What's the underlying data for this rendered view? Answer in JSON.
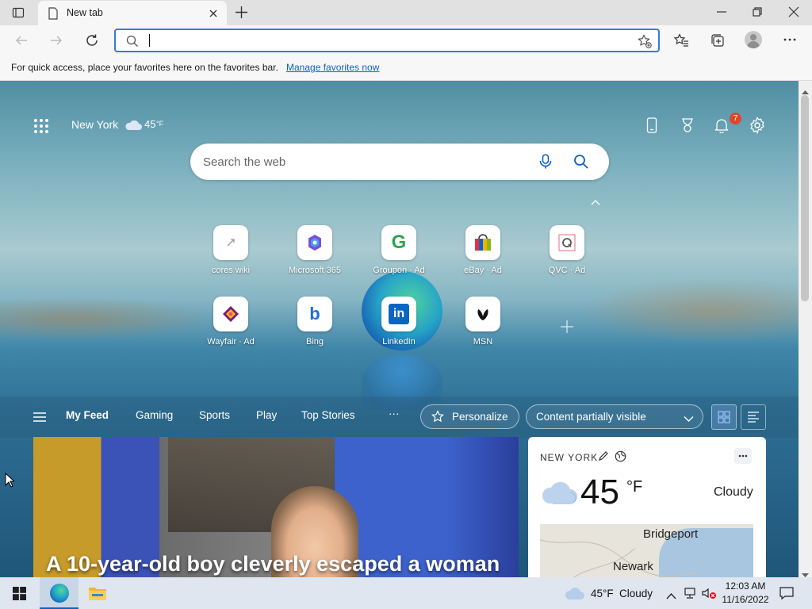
{
  "tab": {
    "title": "New tab"
  },
  "toolbar": {
    "address_value": "",
    "address_placeholder": ""
  },
  "favorites_bar": {
    "message": "For quick access, place your favorites here on the favorites bar.",
    "link": "Manage favorites now"
  },
  "header": {
    "location": "New York",
    "temperature": "45",
    "unit": "°F",
    "notification_count": "7"
  },
  "search": {
    "placeholder": "Search the web"
  },
  "quick_links": [
    {
      "label": "cores wiki",
      "icon": "cores-wiki-icon"
    },
    {
      "label": "Microsoft 365",
      "icon": "microsoft-365-icon"
    },
    {
      "label": "Groupon · Ad",
      "icon": "groupon-icon"
    },
    {
      "label": "eBay · Ad",
      "icon": "ebay-icon"
    },
    {
      "label": "QVC · Ad",
      "icon": "qvc-icon"
    },
    {
      "label": "Wayfair · Ad",
      "icon": "wayfair-icon"
    },
    {
      "label": "Bing",
      "icon": "bing-icon"
    },
    {
      "label": "LinkedIn",
      "icon": "linkedin-icon"
    },
    {
      "label": "MSN",
      "icon": "msn-icon"
    }
  ],
  "feed_nav": {
    "items": [
      "My Feed",
      "Gaming",
      "Sports",
      "Play",
      "Top Stories"
    ],
    "more": "···",
    "personalize": "Personalize",
    "content_visibility": "Content partially visible"
  },
  "hero": {
    "headline": "A 10-year-old boy cleverly escaped a woman"
  },
  "weather_card": {
    "location": "NEW YORK",
    "temperature": "45",
    "unit": "°F",
    "condition": "Cloudy",
    "map_labels": [
      "Bridgeport",
      "Newark"
    ]
  },
  "taskbar": {
    "weather_temp": "45°F",
    "weather_condition": "Cloudy",
    "time": "12:03 AM",
    "date": "11/16/2022"
  },
  "colors": {
    "accent": "#2f7fd8",
    "notification": "#e0452b",
    "taskbar": "#dfe6ef"
  }
}
